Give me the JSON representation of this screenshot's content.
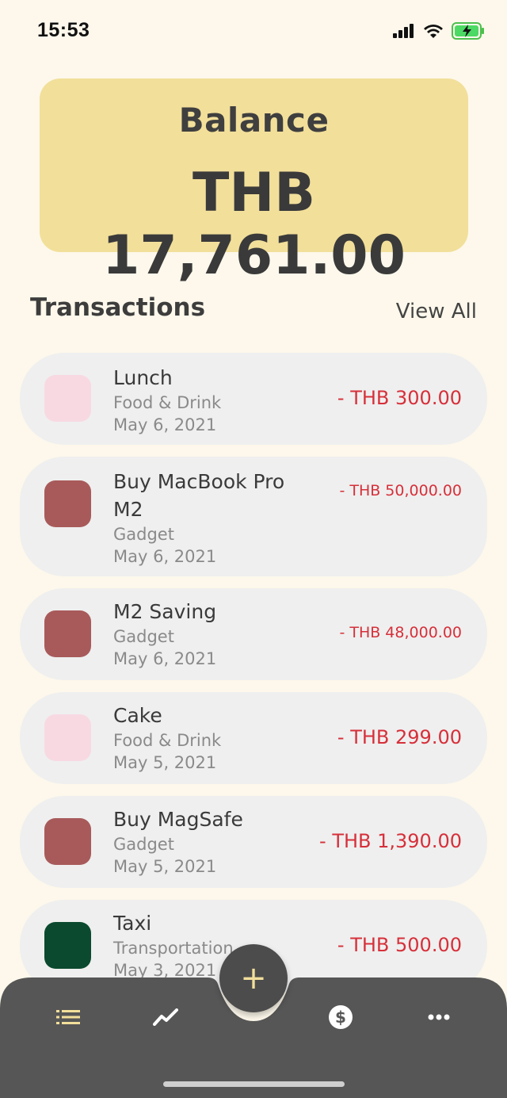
{
  "status": {
    "time": "15:53"
  },
  "balance": {
    "label": "Balance",
    "amount": "THB 17,761.00"
  },
  "transactions_section": {
    "title": "Transactions",
    "view_all": "View All"
  },
  "transactions": [
    {
      "name": "Lunch",
      "category": "Food & Drink",
      "date": "May 6, 2021",
      "amount": "- THB 300.00",
      "color": "#F8D9E2"
    },
    {
      "name": "Buy MacBook Pro M2",
      "category": "Gadget",
      "date": "May 6, 2021",
      "amount": "- THB 50,000.00",
      "color": "#A85A5A"
    },
    {
      "name": "M2 Saving",
      "category": "Gadget",
      "date": "May 6, 2021",
      "amount": "- THB 48,000.00",
      "color": "#A85A5A"
    },
    {
      "name": "Cake",
      "category": "Food & Drink",
      "date": "May 5, 2021",
      "amount": "- THB 299.00",
      "color": "#F8D9E2"
    },
    {
      "name": "Buy MagSafe",
      "category": "Gadget",
      "date": "May 5, 2021",
      "amount": "- THB 1,390.00",
      "color": "#A85A5A"
    },
    {
      "name": "Taxi",
      "category": "Transportation",
      "date": "May 3, 2021",
      "amount": "- THB 500.00",
      "color": "#0B4A2E"
    }
  ],
  "nav": {
    "items": [
      "list-icon",
      "trend-icon",
      "add-icon",
      "dollar-icon",
      "more-icon"
    ],
    "fab_symbol": "+",
    "active_color": "#F2DF9A",
    "bar_color": "#565656"
  }
}
